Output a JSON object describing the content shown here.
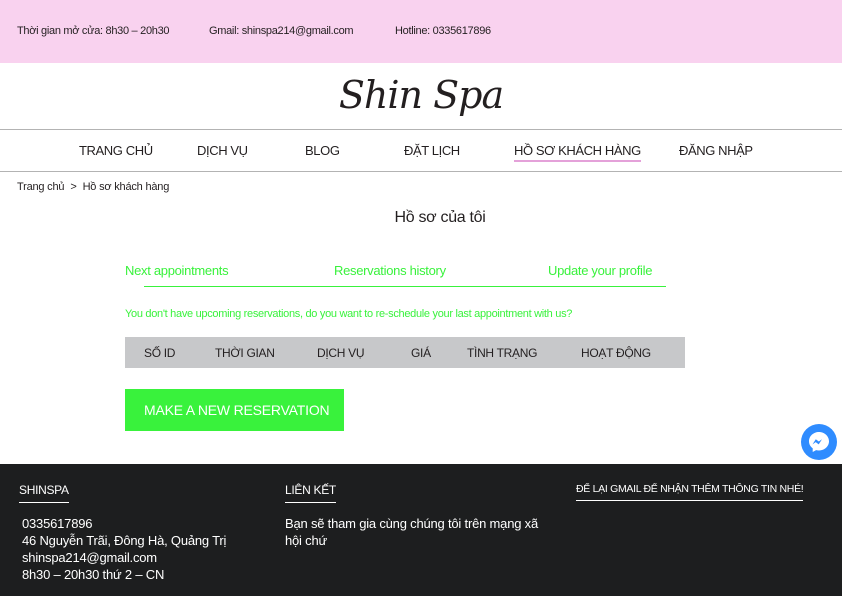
{
  "topbar": {
    "hours": "Thời gian mở cửa: 8h30 – 20h30",
    "email": "Gmail: shinspa214@gmail.com",
    "hotline": "Hotline: 0335617896"
  },
  "logo": "Shin Spa",
  "nav": {
    "home": "TRANG CHỦ",
    "services": "DỊCH VỤ",
    "blog": "BLOG",
    "booking": "ĐẶT LỊCH",
    "profile": "HỒ SƠ KHÁCH HÀNG",
    "login": "ĐĂNG NHẬP"
  },
  "breadcrumb": {
    "home": "Trang chủ",
    "separator": ">",
    "current": "Hồ sơ khách hàng"
  },
  "page_title": "Hồ sơ của tôi",
  "tabs": {
    "next": "Next appointments",
    "history": "Reservations history",
    "update": "Update your profile"
  },
  "notice": "You don't have upcoming reservations, do you want to re-schedule your last appointment with us?",
  "table": {
    "columns": [
      "SỐ ID",
      "THỜI GIAN",
      "DỊCH VỤ",
      "GIÁ",
      "TÌNH TRẠNG",
      "HOẠT ĐỘNG"
    ]
  },
  "cta_label": "MAKE A NEW RESERVATION",
  "footer": {
    "brand_heading": "SHINSPA",
    "links_heading": "LIÊN KẾT",
    "subscribe_heading": "ĐỂ LẠI GMAIL ĐỂ NHẬN THÊM THÔNG TIN NHÉ!",
    "phone": "0335617896",
    "address": "46 Nguyễn Trãi, Đông Hà, Quảng Trị",
    "email": "shinspa214@gmail.com",
    "hours": "8h30 – 20h30 thứ 2 – CN",
    "links_text": "Bạn sẽ tham gia cùng chúng tôi trên mạng xã hội chứ"
  },
  "colors": {
    "topbar": "#f9d2ef",
    "accent_green": "#39f23c",
    "nav_underline": "#e4a1d9",
    "table_header": "#c7c8ca",
    "footer_bg": "#1d1e1f",
    "messenger": "#2f8cff"
  },
  "icons": {
    "chat": "messenger-icon"
  }
}
